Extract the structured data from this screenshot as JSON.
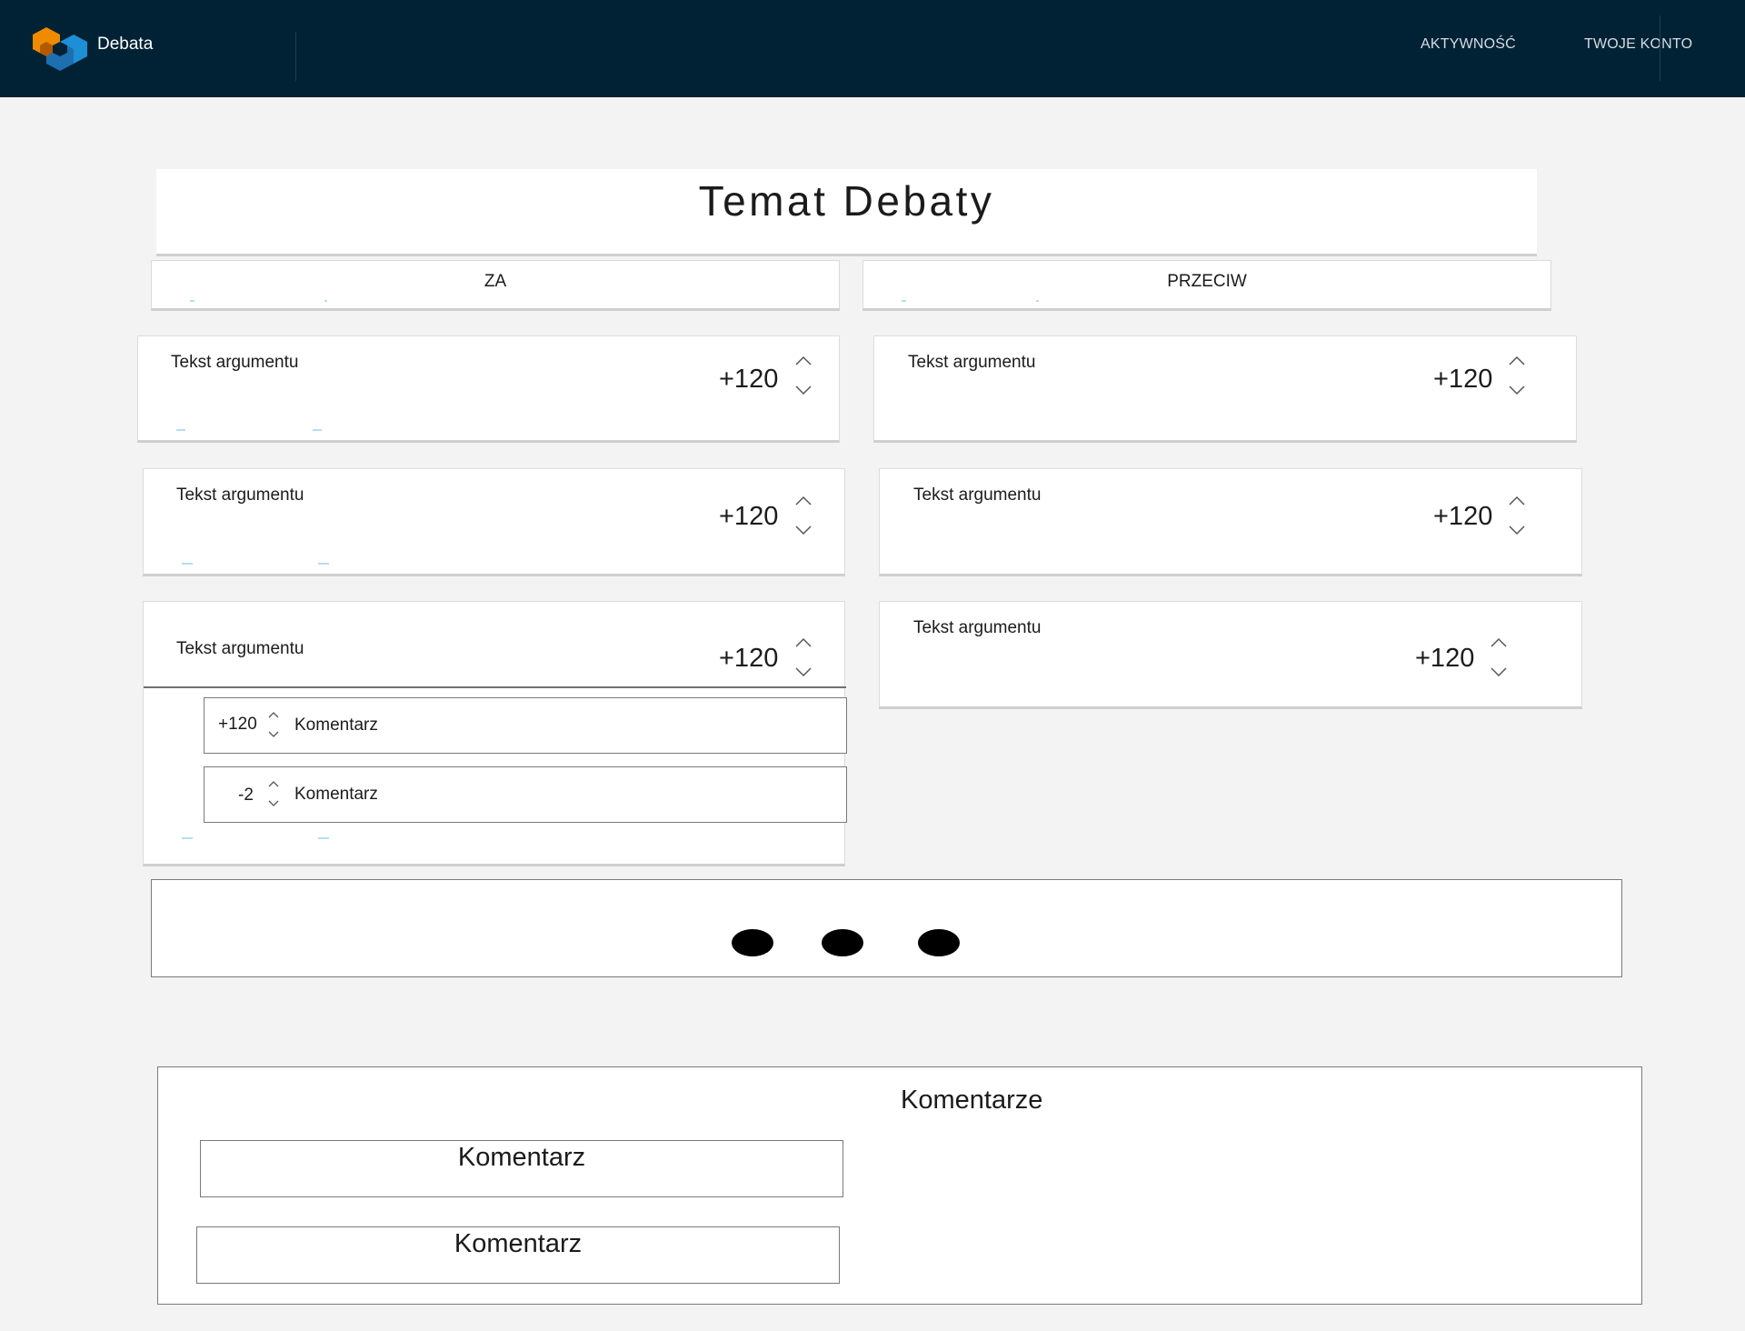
{
  "header": {
    "brand": "Debata",
    "logo_icon": "debata-hexagon-logo",
    "nav": [
      "AKTYWNOŚĆ",
      "TWOJE KONTO"
    ],
    "colors": {
      "background": "#012235",
      "logo_orange": "#f08a00",
      "logo_blue": "#1e8fd6"
    }
  },
  "title": "Temat Debaty",
  "tabs": {
    "za": "ZA",
    "przeciw": "PRZECIW"
  },
  "arguments_za": [
    {
      "text": "Tekst argumentu",
      "score": "+120"
    },
    {
      "text": "Tekst argumentu",
      "score": "+120"
    },
    {
      "text": "Tekst argumentu",
      "score": "+120",
      "comments": [
        {
          "score": "+120",
          "text": "Komentarz"
        },
        {
          "score": "-2",
          "text": "Komentarz"
        }
      ]
    }
  ],
  "arguments_przeciw": [
    {
      "text": "Tekst argumentu",
      "score": "+120"
    },
    {
      "text": "Tekst argumentu",
      "score": "+120"
    },
    {
      "text": "Tekst argumentu",
      "score": "+120"
    }
  ],
  "comments_section": {
    "title": "Komentarze",
    "items": [
      "Komentarz",
      "Komentarz"
    ]
  }
}
